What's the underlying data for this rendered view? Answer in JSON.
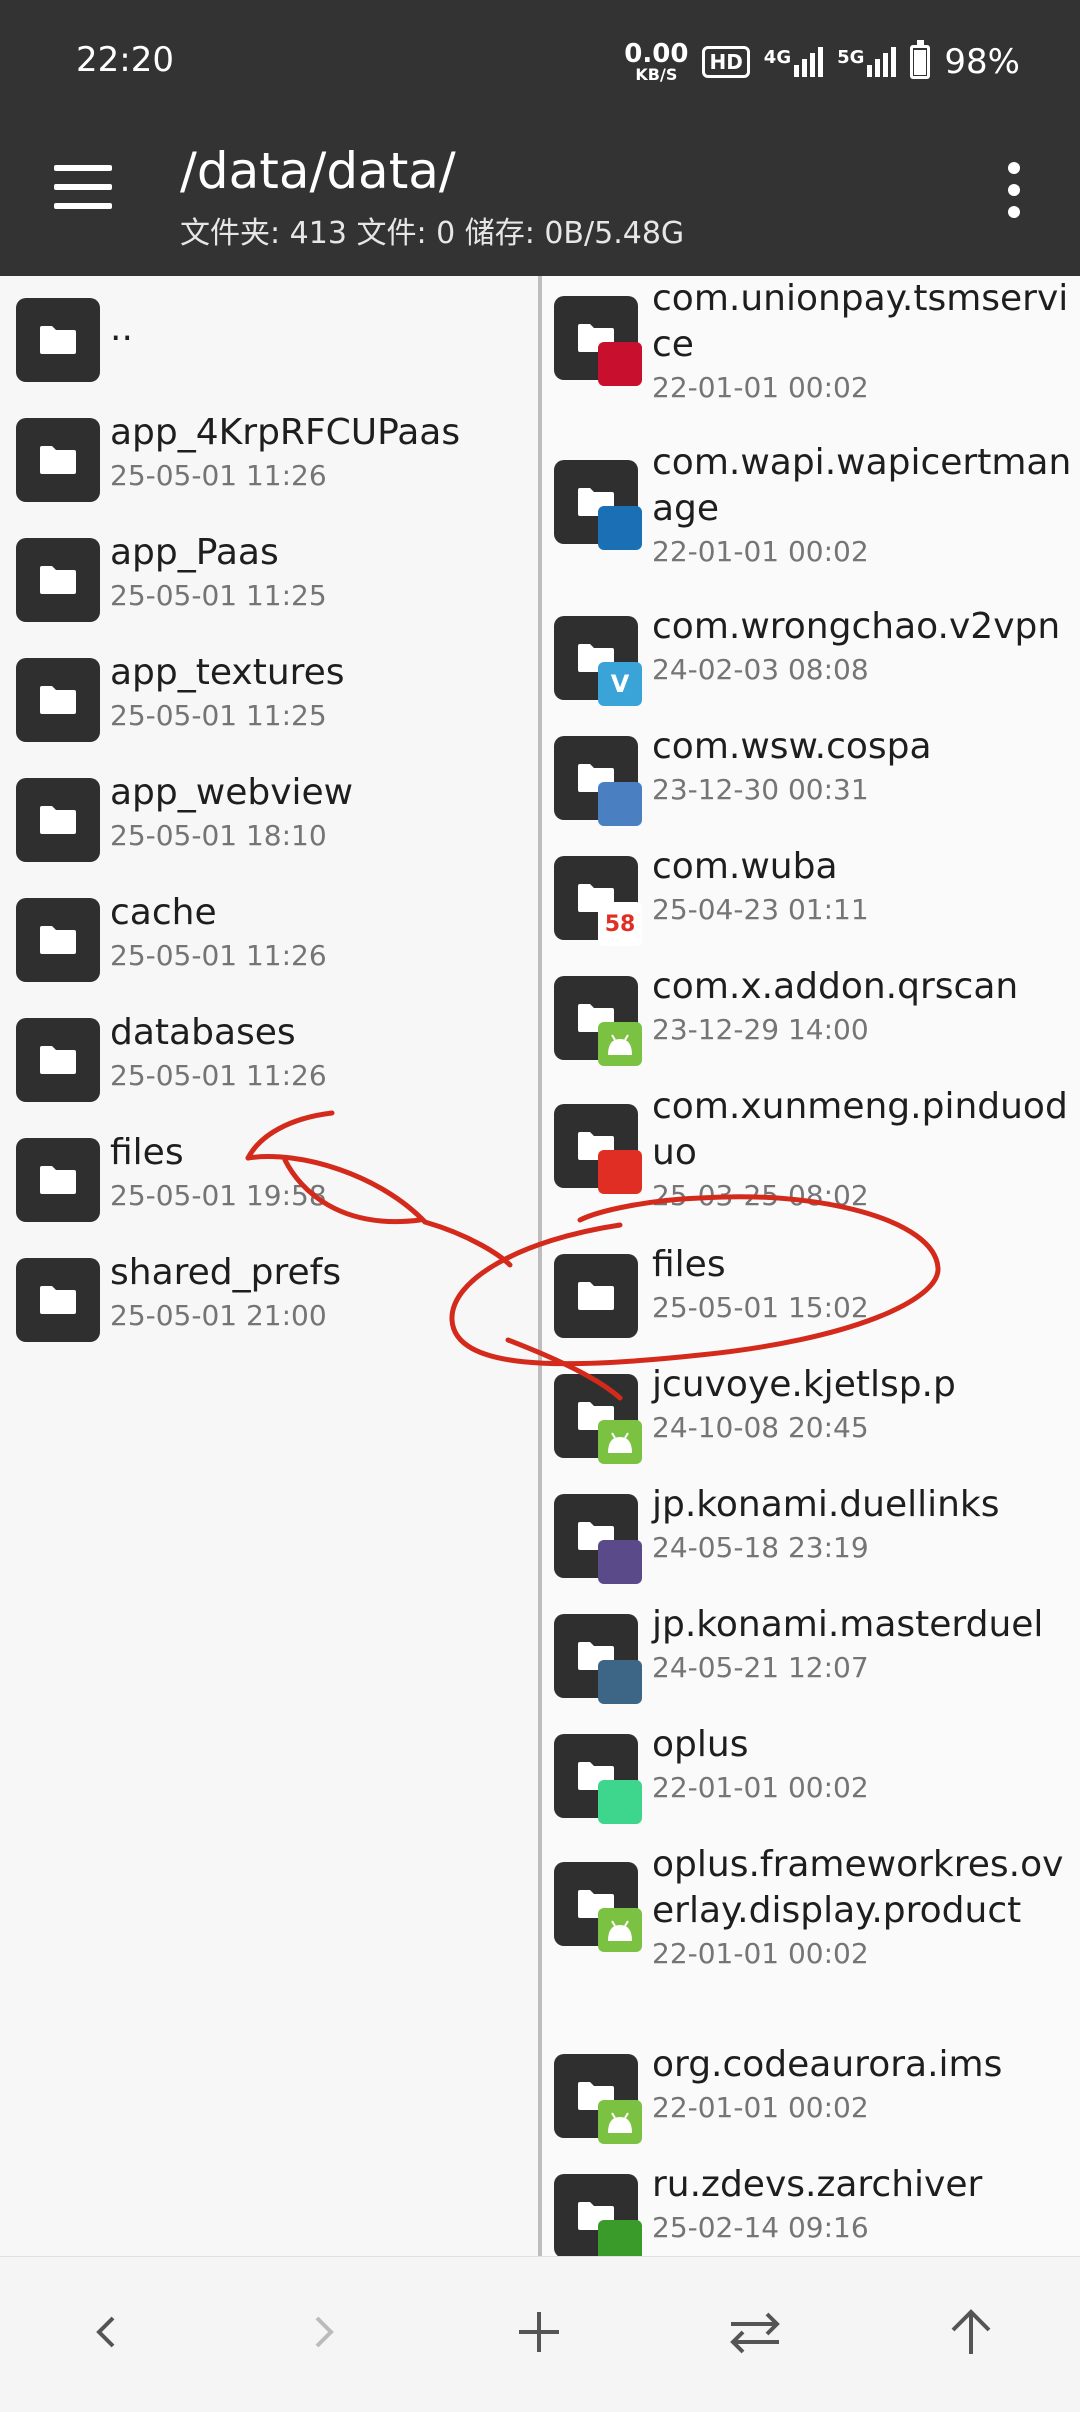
{
  "status_bar": {
    "time": "22:20",
    "speed_value": "0.00",
    "speed_unit": "KB/S",
    "hd": "HD",
    "net1": "4G",
    "net2": "5G",
    "battery": "98%"
  },
  "header": {
    "path": "/data/data/",
    "info": "文件夹: 413  文件: 0  储存: 0B/5.48G"
  },
  "left_pane": {
    "parent": "..",
    "items": [
      {
        "name": "app_4KrpRFCUPaas",
        "date": "25-05-01 11:26"
      },
      {
        "name": "app_Paas",
        "date": "25-05-01 11:25"
      },
      {
        "name": "app_textures",
        "date": "25-05-01 11:25"
      },
      {
        "name": "app_webview",
        "date": "25-05-01 18:10"
      },
      {
        "name": "cache",
        "date": "25-05-01 11:26"
      },
      {
        "name": "databases",
        "date": "25-05-01 11:26"
      },
      {
        "name": "files",
        "date": "25-05-01 19:58"
      },
      {
        "name": "shared_prefs",
        "date": "25-05-01 21:00"
      }
    ]
  },
  "right_pane": {
    "items": [
      {
        "name1": "com.unionpay.tsmservi",
        "name2": "ce",
        "date": "22-01-01 00:02",
        "badge": "unionpay-icon",
        "badge_color": "#c8102e",
        "badge_text": ""
      },
      {
        "name1": "com.wapi.wapicertman",
        "name2": "age",
        "date": "22-01-01 00:02",
        "badge": "wapi-icon",
        "badge_color": "#1a6fb5",
        "badge_text": ""
      },
      {
        "name1": "com.wrongchao.v2vpn",
        "name2": "",
        "date": "24-02-03 08:08",
        "badge": "v2vpn-icon",
        "badge_color": "#3aa3d8",
        "badge_text": "V"
      },
      {
        "name1": "com.wsw.cospa",
        "name2": "",
        "date": "23-12-30 00:31",
        "badge": "cospa-icon",
        "badge_color": "#4a7fc1",
        "badge_text": ""
      },
      {
        "name1": "com.wuba",
        "name2": "",
        "date": "25-04-23 01:11",
        "badge": "wuba-icon",
        "badge_color": "#ffffff",
        "badge_text": "58"
      },
      {
        "name1": "com.x.addon.qrscan",
        "name2": "",
        "date": "23-12-29 14:00",
        "badge": "android-icon",
        "badge_color": "#7cc242",
        "badge_text": ""
      },
      {
        "name1": "com.xunmeng.pinduod",
        "name2": "uo",
        "date": "25-03-25 08:02",
        "badge": "pinduoduo-icon",
        "badge_color": "#e02e24",
        "badge_text": ""
      },
      {
        "name1": "files",
        "name2": "",
        "date": "25-05-01 15:02",
        "badge": "",
        "badge_color": "",
        "badge_text": ""
      },
      {
        "name1": "jcuvoye.kjetlsp.p",
        "name2": "",
        "date": "24-10-08 20:45",
        "badge": "android-icon",
        "badge_color": "#7cc242",
        "badge_text": ""
      },
      {
        "name1": "jp.konami.duellinks",
        "name2": "",
        "date": "24-05-18 23:19",
        "badge": "duellinks-icon",
        "badge_color": "#5a4a8a",
        "badge_text": ""
      },
      {
        "name1": "jp.konami.masterduel",
        "name2": "",
        "date": "24-05-21 12:07",
        "badge": "masterduel-icon",
        "badge_color": "#3d6585",
        "badge_text": ""
      },
      {
        "name1": "oplus",
        "name2": "",
        "date": "22-01-01 00:02",
        "badge": "oplus-icon",
        "badge_color": "#3dd68c",
        "badge_text": ""
      },
      {
        "name1": "oplus.frameworkres.ov",
        "name2": "erlay.display.product",
        "date": "22-01-01 00:02",
        "badge": "android-icon",
        "badge_color": "#7cc242",
        "badge_text": ""
      },
      {
        "name1": "org.codeaurora.ims",
        "name2": "",
        "date": "22-01-01 00:02",
        "badge": "android-icon",
        "badge_color": "#7cc242",
        "badge_text": ""
      },
      {
        "name1": "ru.zdevs.zarchiver",
        "name2": "",
        "date": "25-02-14 09:16",
        "badge": "zarchiver-icon",
        "badge_color": "#3a9a2a",
        "badge_text": ""
      }
    ]
  },
  "bottom_bar": {
    "buttons": [
      "back-icon",
      "forward-icon",
      "add-icon",
      "swap-icon",
      "up-icon"
    ]
  },
  "colors": {
    "header_bg": "#333333",
    "annotation": "#d42a1c",
    "folder": "#2f2f2f"
  }
}
